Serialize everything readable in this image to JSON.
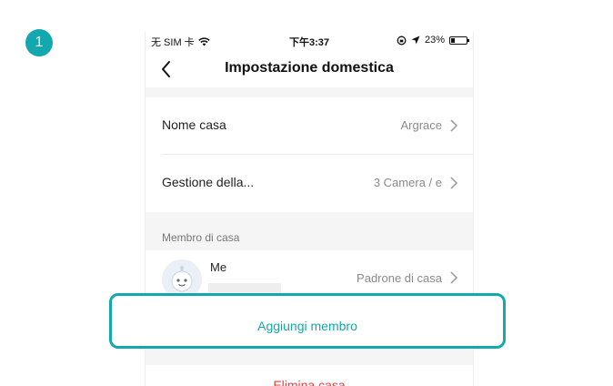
{
  "step": {
    "number": "1"
  },
  "status_bar": {
    "carrier": "无 SIM 卡",
    "time": "下午3:37",
    "battery_percent": "23%",
    "battery_level": 0.23
  },
  "nav": {
    "title": "Impostazione domestica"
  },
  "settings": {
    "home_name_label": "Nome casa",
    "home_name_value": "Argrace",
    "rooms_label": "Gestione della...",
    "rooms_value": "3 Camera / e"
  },
  "members": {
    "section_title": "Membro di casa",
    "items": [
      {
        "name": "Me",
        "role": "Padrone di casa"
      }
    ],
    "add_label": "Aggiungi membro"
  },
  "actions": {
    "delete_label": "Elimina casa"
  },
  "colors": {
    "accent": "#13a8ad",
    "danger": "#e64340"
  }
}
